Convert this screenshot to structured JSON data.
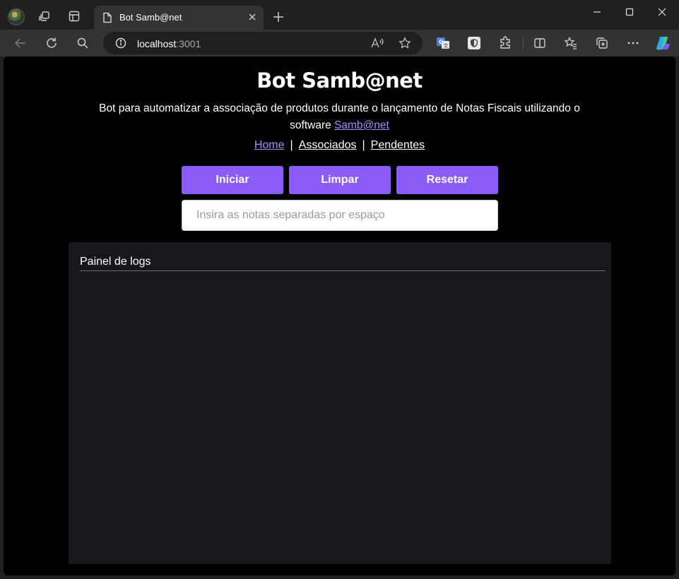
{
  "browser": {
    "tab_title": "Bot Samb@net",
    "url_host": "localhost",
    "url_port": ":3001",
    "icons": [
      "profile-avatar",
      "workspaces-icon",
      "tab-actions-icon",
      "page-icon",
      "close-icon",
      "new-tab-icon",
      "back-icon",
      "refresh-icon",
      "search-icon",
      "info-icon",
      "read-aloud-icon",
      "favorite-star-icon",
      "translate-icon",
      "shield-extension-icon",
      "extensions-icon",
      "split-screen-icon",
      "favorites-icon",
      "collections-icon",
      "more-icon",
      "copilot-icon"
    ]
  },
  "page": {
    "title": "Bot Samb@net",
    "description": "Bot para automatizar a associação de produtos durante o lançamento de Notas Fiscais utilizando o software",
    "description_link": "Samb@net",
    "nav": [
      {
        "label": "Home",
        "active": true
      },
      {
        "label": "Associados",
        "active": false
      },
      {
        "label": "Pendentes",
        "active": false
      }
    ],
    "nav_separator": "|",
    "buttons": {
      "start": "Iniciar",
      "clear": "Limpar",
      "reset": "Resetar"
    },
    "notes_input": {
      "placeholder": "Insira as notas separadas por espaço",
      "value": ""
    },
    "log_panel": {
      "title": "Painel de logs"
    }
  },
  "colors": {
    "accent": "#8b5cf6",
    "link": "#a78bfa",
    "page_background": "#000000",
    "panel_background": "#18181b"
  }
}
